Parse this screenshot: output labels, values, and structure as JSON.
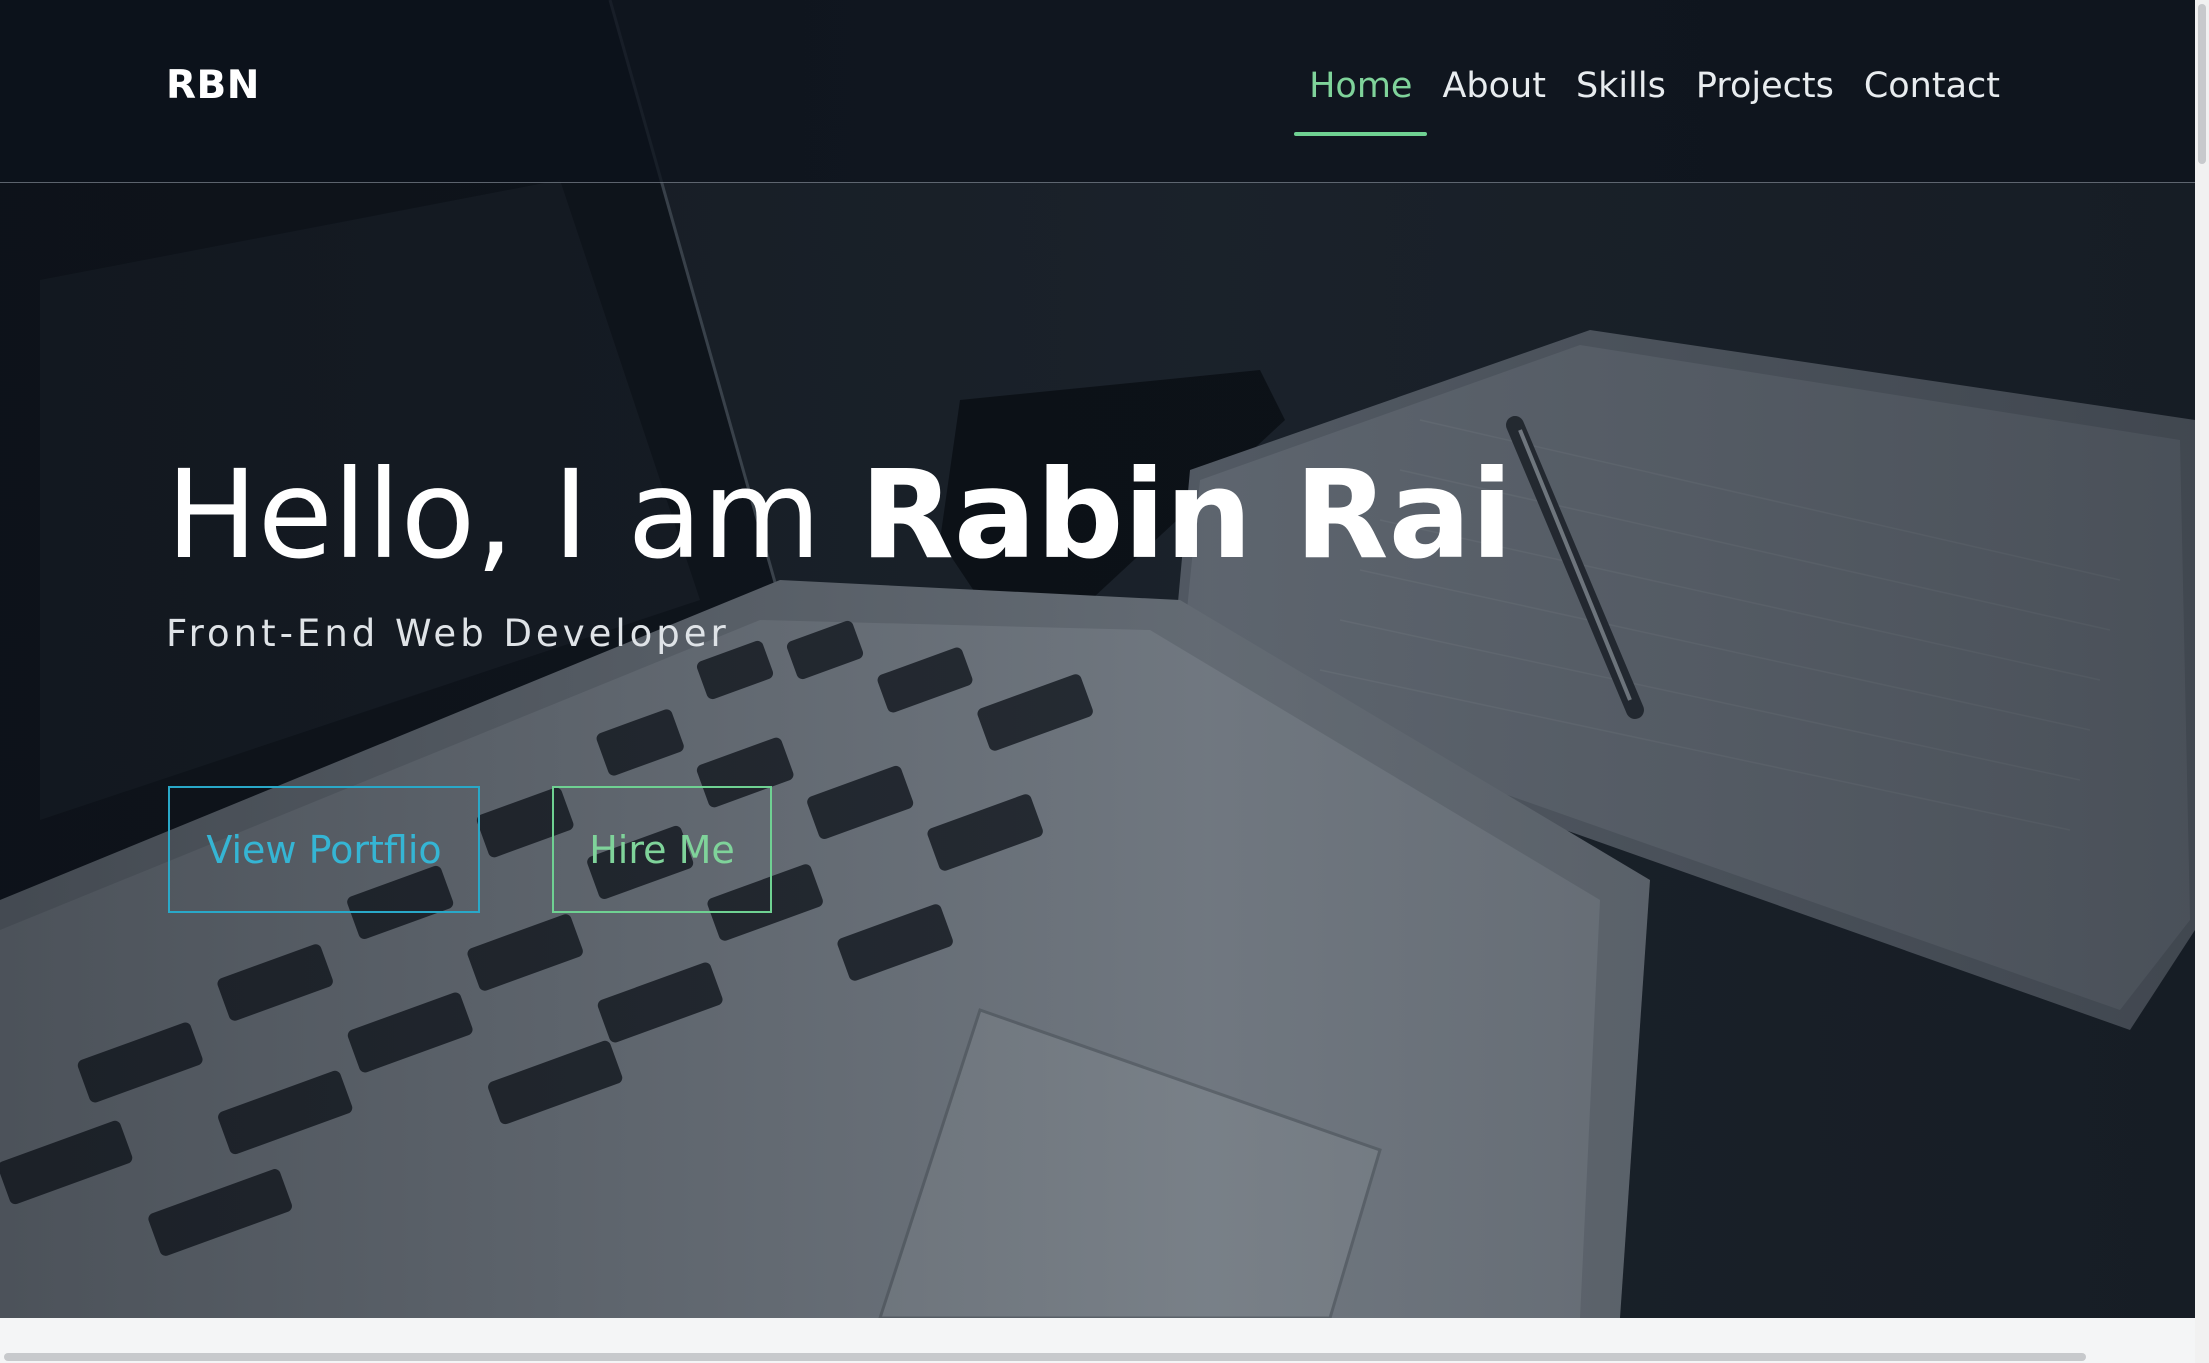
{
  "nav": {
    "brand": "RBN",
    "links": [
      {
        "label": "Home",
        "active": true
      },
      {
        "label": "About",
        "active": false
      },
      {
        "label": "Skills",
        "active": false
      },
      {
        "label": "Projects",
        "active": false
      },
      {
        "label": "Contact",
        "active": false
      }
    ]
  },
  "hero": {
    "greeting": "Hello, I am ",
    "name": "Rabin Rai",
    "subtitle": "Front-End Web Developer",
    "buttons": {
      "portfolio": "View Portflio",
      "hire": "Hire Me"
    },
    "background_description_icon": "laptop-notebook-pen-photo"
  },
  "colors": {
    "accent_green": "#7fd39a",
    "accent_blue": "#35b5d4",
    "nav_text": "#e8ecef"
  }
}
